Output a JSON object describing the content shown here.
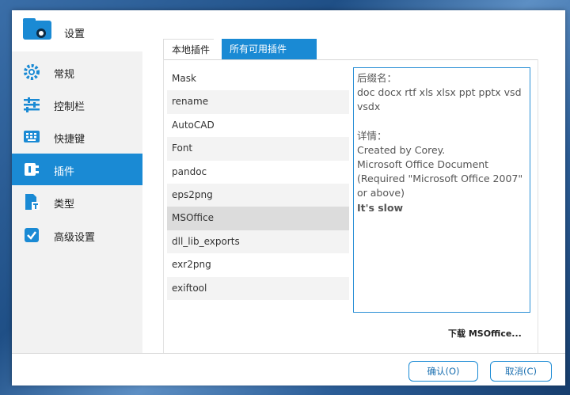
{
  "sidebar": {
    "title": "设置",
    "items": [
      {
        "label": "常规",
        "icon": "gear-icon"
      },
      {
        "label": "控制栏",
        "icon": "sliders-icon"
      },
      {
        "label": "快捷键",
        "icon": "keyboard-icon"
      },
      {
        "label": "插件",
        "icon": "plugin-icon"
      },
      {
        "label": "类型",
        "icon": "file-type-icon"
      },
      {
        "label": "高级设置",
        "icon": "checkbox-icon"
      }
    ],
    "active_index": 3
  },
  "tabs": [
    {
      "label": "本地插件"
    },
    {
      "label": "所有可用插件"
    }
  ],
  "plugins": [
    "Mask",
    "rename",
    "AutoCAD",
    "Font",
    "pandoc",
    "eps2png",
    "MSOffice",
    "dll_lib_exports",
    "exr2png",
    "exiftool"
  ],
  "selected_plugin": "MSOffice",
  "detail": {
    "suffix_label": "后缀名：",
    "suffixes": "doc docx rtf xls xlsx ppt pptx vsd vsdx",
    "info_label": "详情：",
    "line1": "Created by Corey.",
    "line2": "Microsoft Office Document",
    "line3": "(Required \"Microsoft Office 2007\" or above)",
    "note": "It's slow"
  },
  "download_label": "下载 MSOffice...",
  "buttons": {
    "ok": "确认(O)",
    "cancel": "取消(C)"
  },
  "colors": {
    "accent": "#1a8ad4"
  }
}
